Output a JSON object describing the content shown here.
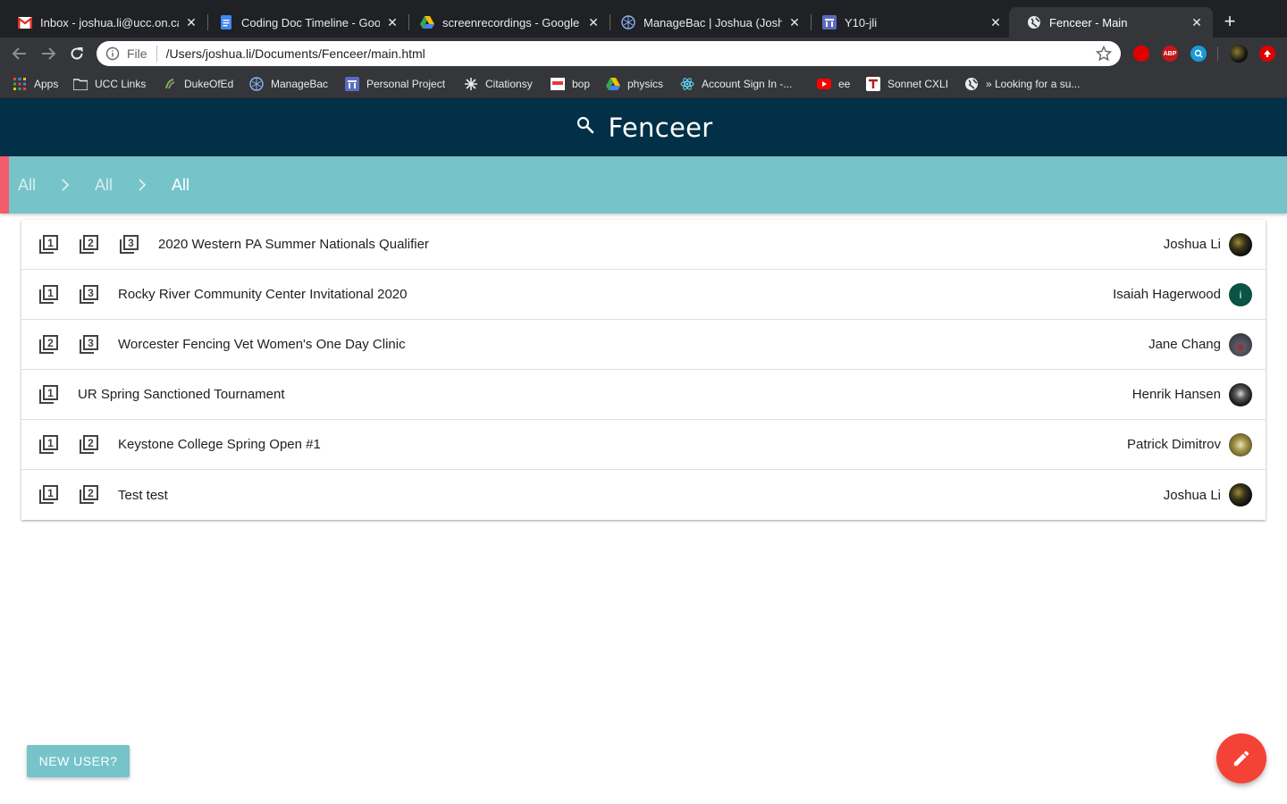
{
  "browser": {
    "tabs": [
      {
        "title": "Inbox - joshua.li@ucc.on.ca",
        "icon": "gmail-icon"
      },
      {
        "title": "Coding Doc Timeline - Google Docs",
        "icon": "docs-icon"
      },
      {
        "title": "screenrecordings - Google Drive",
        "icon": "drive-icon"
      },
      {
        "title": "ManageBac | Joshua (Joshua) Li",
        "icon": "managebac-icon"
      },
      {
        "title": "Y10-jli",
        "icon": "classroom-icon"
      },
      {
        "title": "Fenceer - Main",
        "icon": "globe-icon",
        "active": true
      }
    ],
    "address": {
      "scheme": "File",
      "url": "/Users/joshua.li/Documents/Fenceer/main.html"
    },
    "bookmarks": [
      {
        "label": "Apps",
        "icon": "apps-grid-icon"
      },
      {
        "label": "UCC Links",
        "icon": "folder-icon"
      },
      {
        "label": "DukeOfEd",
        "icon": "dukeofed-icon"
      },
      {
        "label": "ManageBac",
        "icon": "managebac-icon"
      },
      {
        "label": "Personal Project",
        "icon": "classroom-icon"
      },
      {
        "label": "Citationsy",
        "icon": "citationsy-icon"
      },
      {
        "label": "bop",
        "icon": "bop-icon"
      },
      {
        "label": "physics",
        "icon": "drive-icon"
      },
      {
        "label": "Account Sign In -...",
        "icon": "react-icon"
      },
      {
        "label": "ee",
        "icon": "youtube-icon"
      },
      {
        "label": "Sonnet CXLI",
        "icon": "sonnet-icon"
      },
      {
        "label": "» Looking for a su...",
        "icon": "globe-icon"
      }
    ]
  },
  "app": {
    "title": "Fenceer",
    "breadcrumbs": [
      "All",
      "All",
      "All"
    ],
    "tournaments": [
      {
        "title": "2020 Western PA Summer Nationals Qualifier",
        "levels": [
          "1",
          "2",
          "3"
        ],
        "author": "Joshua Li",
        "avatar": "photo-dark"
      },
      {
        "title": "Rocky River Community Center Invitational 2020",
        "levels": [
          "1",
          "3"
        ],
        "author": "Isaiah Hagerwood",
        "avatar": "letter",
        "avatar_letter": "i"
      },
      {
        "title": "Worcester Fencing Vet Women's One Day Clinic",
        "levels": [
          "2",
          "3"
        ],
        "author": "Jane Chang",
        "avatar": "photo-grey"
      },
      {
        "title": "UR Spring Sanctioned Tournament",
        "levels": [
          "1"
        ],
        "author": "Henrik Hansen",
        "avatar": "photo-bw"
      },
      {
        "title": "Keystone College Spring Open #1",
        "levels": [
          "1",
          "2"
        ],
        "author": "Patrick Dimitrov",
        "avatar": "photo-olive"
      },
      {
        "title": "Test test",
        "levels": [
          "1",
          "2"
        ],
        "author": "Joshua Li",
        "avatar": "photo-dark"
      }
    ],
    "new_user_label": "NEW USER?",
    "fab_icon": "edit-pencil-icon",
    "colors": {
      "header": "#023047",
      "breadcrumb_bar": "#76c4ca",
      "accent": "#f25c6b",
      "fab": "#f44336"
    }
  }
}
